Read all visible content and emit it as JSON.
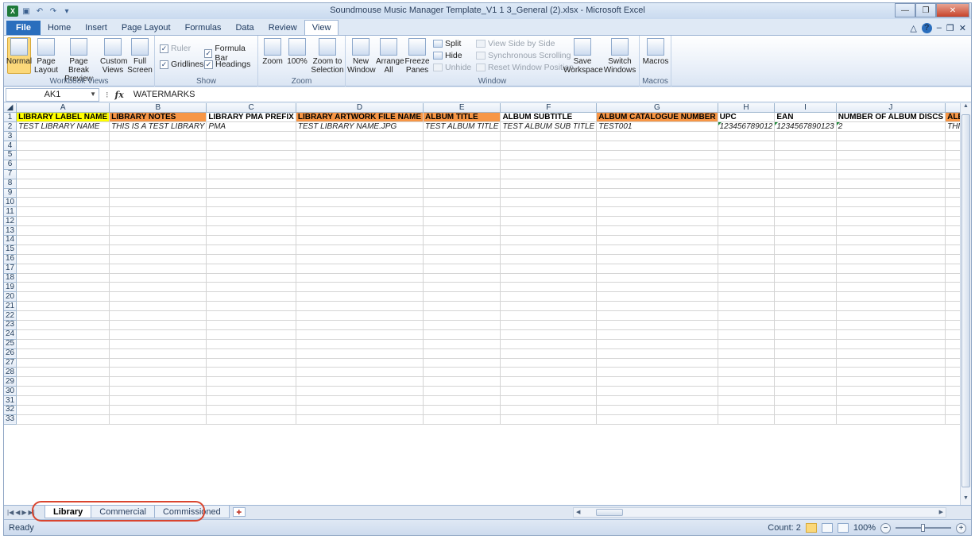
{
  "window": {
    "title": "Soundmouse Music Manager Template_V1 1 3_General (2).xlsx - Microsoft Excel",
    "app_icon": "X"
  },
  "ribbon_tabs": [
    "File",
    "Home",
    "Insert",
    "Page Layout",
    "Formulas",
    "Data",
    "Review",
    "View"
  ],
  "active_tab": "View",
  "ribbon": {
    "workbook_views": {
      "label": "Workbook Views",
      "normal": "Normal",
      "page_layout": "Page Layout",
      "page_break": "Page Break Preview",
      "custom_views": "Custom Views",
      "full_screen": "Full Screen"
    },
    "show": {
      "label": "Show",
      "ruler": "Ruler",
      "formula_bar": "Formula Bar",
      "gridlines": "Gridlines",
      "headings": "Headings"
    },
    "zoom": {
      "label": "Zoom",
      "zoom": "Zoom",
      "hundred": "100%",
      "zoom_to_selection": "Zoom to Selection"
    },
    "window": {
      "label": "Window",
      "new_window": "New Window",
      "arrange_all": "Arrange All",
      "freeze_panes": "Freeze Panes",
      "split": "Split",
      "hide": "Hide",
      "unhide": "Unhide",
      "view_side_by_side": "View Side by Side",
      "synchronous_scrolling": "Synchronous Scrolling",
      "reset_window_position": "Reset Window Position",
      "save_workspace": "Save Workspace",
      "switch_windows": "Switch Windows"
    },
    "macros": {
      "label": "Macros",
      "macros": "Macros"
    }
  },
  "formula_bar": {
    "name_box": "AK1",
    "fx": "fx",
    "formula": "WATERMARKS"
  },
  "columns": [
    "A",
    "B",
    "C",
    "D",
    "E",
    "F",
    "G",
    "H",
    "I",
    "J",
    "K"
  ],
  "header_row": [
    {
      "text": "LIBRARY LABEL NAME",
      "fill": "#ffff00"
    },
    {
      "text": "LIBRARY NOTES",
      "fill": "#f79646"
    },
    {
      "text": "LIBRARY PMA PREFIX",
      "fill": ""
    },
    {
      "text": "LIBRARY ARTWORK FILE NAME",
      "fill": "#f79646"
    },
    {
      "text": "ALBUM TITLE",
      "fill": "#f79646"
    },
    {
      "text": "ALBUM SUBTITLE",
      "fill": ""
    },
    {
      "text": "ALBUM CATALOGUE NUMBER",
      "fill": "#f79646"
    },
    {
      "text": "UPC",
      "fill": ""
    },
    {
      "text": "EAN",
      "fill": ""
    },
    {
      "text": "NUMBER OF ALBUM DISCS",
      "fill": ""
    },
    {
      "text": "ALBUM NOTES",
      "fill": "#f79646"
    }
  ],
  "data_row": [
    "TEST LIBRARY NAME",
    "THIS IS A TEST LIBRARY",
    "PMA",
    "TEST LIBRARY NAME.JPG",
    "TEST ALBUM TITLE",
    "TEST ALBUM SUB TITLE",
    "TEST001",
    "123456789012",
    "1234567890123",
    "2",
    "THIS IS AN ALBUM NOTE"
  ],
  "row_count": 33,
  "sheets": [
    "Library",
    "Commercial",
    "Commissioned"
  ],
  "active_sheet": "Library",
  "status": {
    "ready": "Ready",
    "count": "Count: 2",
    "zoom": "100%"
  }
}
